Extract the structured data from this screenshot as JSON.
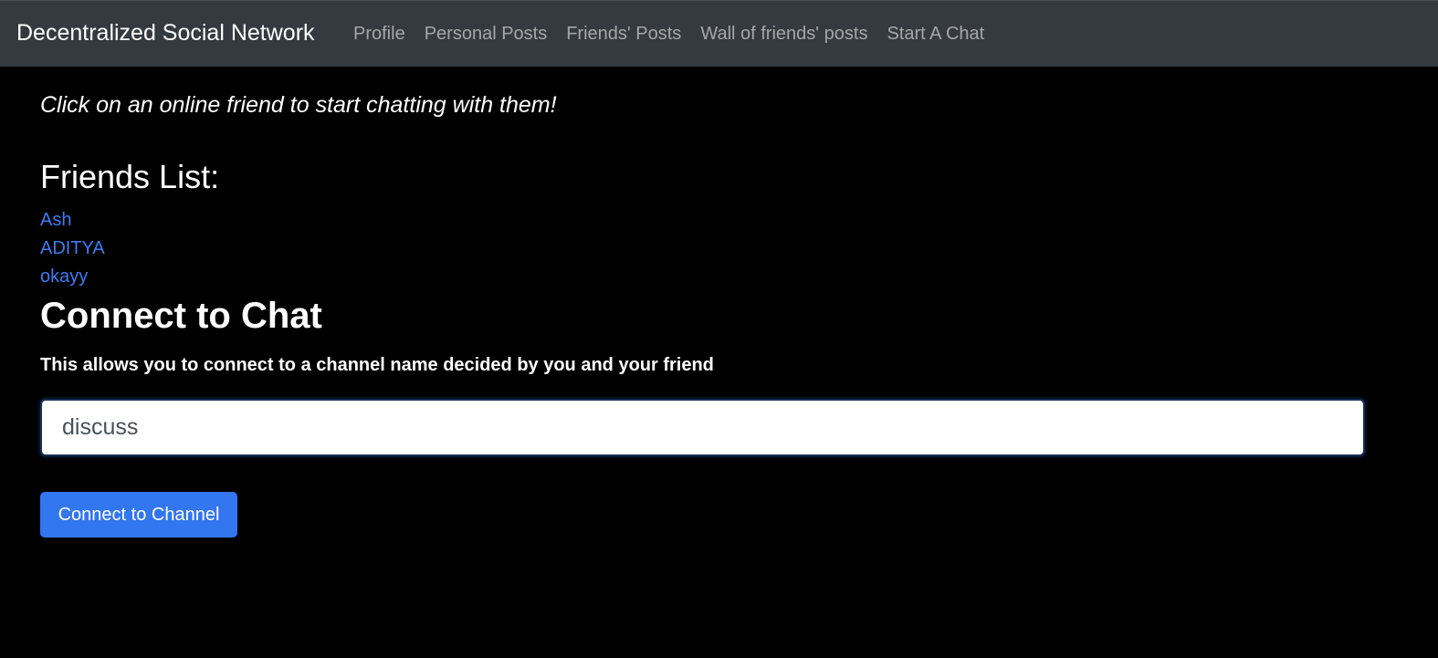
{
  "navbar": {
    "brand": "Decentralized Social Network",
    "links": [
      {
        "label": "Profile"
      },
      {
        "label": "Personal Posts"
      },
      {
        "label": "Friends' Posts"
      },
      {
        "label": "Wall of friends' posts"
      },
      {
        "label": "Start A Chat"
      }
    ]
  },
  "main": {
    "hint": "Click on an online friend to start chatting with them!",
    "friends_heading": "Friends List:",
    "friends": [
      {
        "name": "Ash"
      },
      {
        "name": "ADITYA"
      },
      {
        "name": "okayy"
      }
    ],
    "chat_heading": "Connect to Chat",
    "chat_description": "This allows you to connect to a channel name decided by you and your friend",
    "channel_input_value": "discuss",
    "connect_button_label": "Connect to Channel"
  },
  "colors": {
    "background": "#000000",
    "navbar": "#343a40",
    "link": "#3d7cf5",
    "button": "#3276f0"
  }
}
